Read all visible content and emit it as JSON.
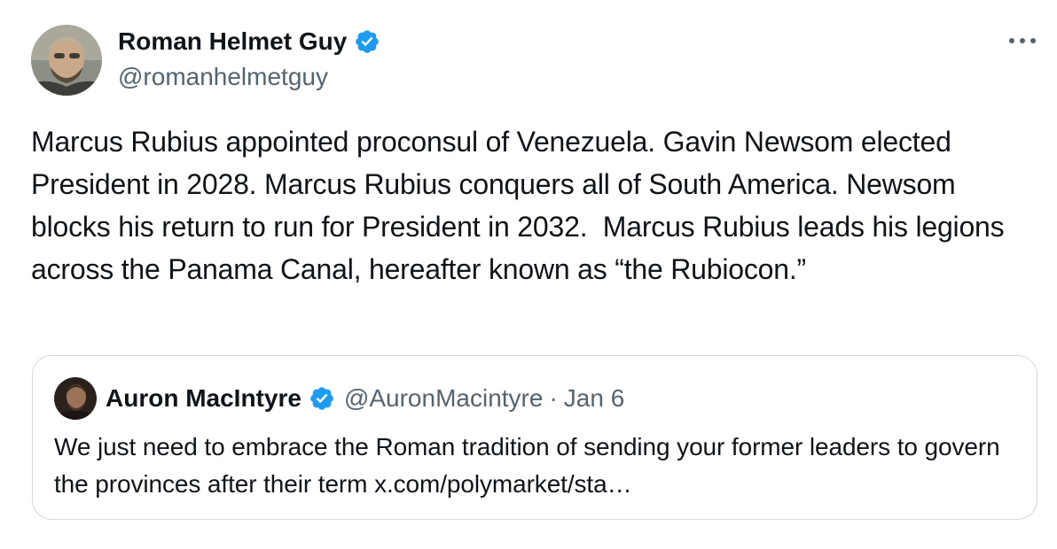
{
  "tweet": {
    "author": {
      "name": "Roman Helmet Guy",
      "handle": "@romanhelmetguy",
      "verified": true
    },
    "text": "Marcus Rubius appointed proconsul of Venezuela. Gavin Newsom elected President in 2028. Marcus Rubius conquers all of South America. Newsom blocks his return to run for President in 2032.  Marcus Rubius leads his legions across the Panama Canal, hereafter known as “the Rubiocon.”",
    "more_icon": "ellipsis-icon"
  },
  "quote": {
    "author": {
      "name": "Auron MacIntyre",
      "handle": "@AuronMacintyre",
      "verified": true
    },
    "separator": "·",
    "date": "Jan 6",
    "text": "We just need to embrace the Roman tradition of sending your former leaders to govern the provinces after their term ",
    "link": "x.com/polymarket/sta…"
  },
  "colors": {
    "verified_blue": "#1d9bf0",
    "secondary_text": "#536471",
    "border": "#cfd9de"
  }
}
